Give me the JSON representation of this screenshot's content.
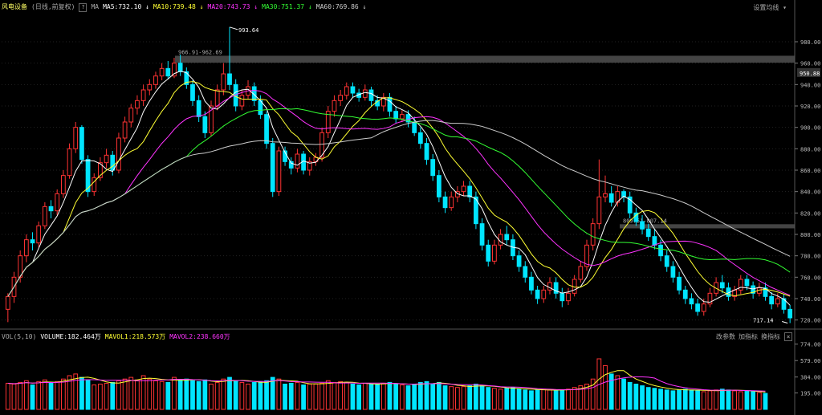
{
  "header": {
    "stock_name": "风电设备",
    "period": "(日线,前复权)",
    "help_label": "?",
    "ma_label": "MA",
    "ma_values": [
      {
        "label": "MA5:732.10",
        "color": "#ffffff"
      },
      {
        "label": "MA10:739.48",
        "color": "#ffff33"
      },
      {
        "label": "MA20:743.73",
        "color": "#ff33ff"
      },
      {
        "label": "MA30:751.37",
        "color": "#33ff33"
      },
      {
        "label": "MA60:769.86",
        "color": "#cccccc"
      }
    ],
    "settings_label": "设置均线"
  },
  "volume_header": {
    "title": "VOL(5,10)",
    "volume": "VOLUME:182.464万",
    "mavol1": "MAVOL1:218.573万",
    "mavol2": "MAVOL2:238.660万",
    "buttons": [
      "改参数",
      "加指标",
      "换指标"
    ],
    "close_label": "×"
  },
  "annotations": {
    "high_label": "993.64",
    "low_label": "717.14",
    "range1": "966.91-962.69",
    "range2": "809.51-807.14",
    "current_price": "950.88"
  },
  "colors": {
    "up": "#ff3333",
    "down": "#00e5ff",
    "ma5": "#ffffff",
    "ma10": "#ffff33",
    "ma20": "#ff33ff",
    "ma30": "#33ff33",
    "ma60": "#cccccc"
  },
  "chart_data": [
    {
      "type": "candlestick",
      "y_ticks": [
        980,
        960,
        940,
        920,
        900,
        880,
        860,
        840,
        820,
        800,
        780,
        760,
        740,
        720
      ],
      "ylim": [
        713,
        1004
      ],
      "candles": [
        [
          730,
          742,
          718,
          745
        ],
        [
          742,
          760,
          736,
          765
        ],
        [
          760,
          780,
          755,
          785
        ],
        [
          780,
          795,
          774,
          800
        ],
        [
          795,
          792,
          785,
          802
        ],
        [
          792,
          808,
          788,
          812
        ],
        [
          808,
          826,
          805,
          830
        ],
        [
          826,
          822,
          815,
          832
        ],
        [
          822,
          838,
          818,
          842
        ],
        [
          838,
          855,
          834,
          860
        ],
        [
          855,
          880,
          852,
          885
        ],
        [
          880,
          900,
          876,
          905
        ],
        [
          900,
          870,
          866,
          902
        ],
        [
          870,
          840,
          835,
          874
        ],
        [
          840,
          853,
          836,
          857
        ],
        [
          853,
          867,
          850,
          872
        ],
        [
          867,
          874,
          862,
          880
        ],
        [
          874,
          860,
          855,
          878
        ],
        [
          860,
          890,
          857,
          895
        ],
        [
          890,
          905,
          886,
          910
        ],
        [
          905,
          918,
          900,
          922
        ],
        [
          918,
          925,
          912,
          930
        ],
        [
          925,
          935,
          920,
          940
        ],
        [
          935,
          940,
          930,
          945
        ],
        [
          940,
          948,
          936,
          952
        ],
        [
          948,
          955,
          944,
          960
        ],
        [
          955,
          948,
          945,
          962
        ],
        [
          948,
          960,
          946,
          965
        ],
        [
          960,
          952,
          948,
          968
        ],
        [
          952,
          940,
          936,
          956
        ],
        [
          940,
          925,
          920,
          944
        ],
        [
          925,
          910,
          905,
          930
        ],
        [
          910,
          895,
          890,
          915
        ],
        [
          895,
          920,
          892,
          925
        ],
        [
          920,
          935,
          916,
          940
        ],
        [
          935,
          950,
          930,
          960
        ],
        [
          950,
          940,
          935,
          993.64
        ],
        [
          940,
          920,
          915,
          945
        ],
        [
          920,
          930,
          916,
          935
        ],
        [
          930,
          938,
          926,
          944
        ],
        [
          938,
          925,
          920,
          942
        ],
        [
          925,
          912,
          908,
          930
        ],
        [
          912,
          885,
          880,
          915
        ],
        [
          885,
          840,
          835,
          890
        ],
        [
          840,
          878,
          836,
          882
        ],
        [
          878,
          868,
          864,
          882
        ],
        [
          868,
          862,
          856,
          872
        ],
        [
          862,
          875,
          858,
          880
        ],
        [
          875,
          860,
          856,
          878
        ],
        [
          860,
          868,
          855,
          872
        ],
        [
          868,
          872,
          864,
          876
        ],
        [
          872,
          895,
          868,
          900
        ],
        [
          895,
          915,
          890,
          920
        ],
        [
          915,
          925,
          910,
          930
        ],
        [
          925,
          930,
          920,
          935
        ],
        [
          930,
          938,
          926,
          942
        ],
        [
          938,
          932,
          928,
          942
        ],
        [
          932,
          928,
          924,
          936
        ],
        [
          928,
          935,
          925,
          940
        ],
        [
          935,
          925,
          920,
          938
        ],
        [
          925,
          920,
          916,
          930
        ],
        [
          920,
          928,
          915,
          932
        ],
        [
          928,
          915,
          910,
          932
        ],
        [
          915,
          908,
          904,
          920
        ],
        [
          908,
          912,
          905,
          916
        ],
        [
          912,
          905,
          900,
          916
        ],
        [
          905,
          895,
          892,
          910
        ],
        [
          895,
          885,
          880,
          900
        ],
        [
          885,
          870,
          865,
          890
        ],
        [
          870,
          855,
          850,
          875
        ],
        [
          855,
          835,
          830,
          860
        ],
        [
          835,
          825,
          820,
          840
        ],
        [
          825,
          835,
          822,
          840
        ],
        [
          835,
          840,
          830,
          845
        ],
        [
          840,
          845,
          836,
          850
        ],
        [
          845,
          835,
          830,
          850
        ],
        [
          835,
          810,
          805,
          840
        ],
        [
          810,
          790,
          785,
          815
        ],
        [
          790,
          775,
          770,
          795
        ],
        [
          775,
          790,
          772,
          795
        ],
        [
          790,
          800,
          786,
          805
        ],
        [
          800,
          795,
          790,
          808
        ],
        [
          795,
          780,
          776,
          800
        ],
        [
          780,
          770,
          765,
          785
        ],
        [
          770,
          760,
          755,
          775
        ],
        [
          760,
          748,
          744,
          765
        ],
        [
          748,
          740,
          735,
          752
        ],
        [
          740,
          748,
          736,
          752
        ],
        [
          748,
          755,
          744,
          760
        ],
        [
          755,
          745,
          740,
          760
        ],
        [
          745,
          738,
          732,
          750
        ],
        [
          738,
          745,
          734,
          750
        ],
        [
          745,
          758,
          742,
          762
        ],
        [
          758,
          770,
          755,
          775
        ],
        [
          770,
          790,
          766,
          795
        ],
        [
          790,
          810,
          785,
          815
        ],
        [
          810,
          835,
          805,
          870
        ],
        [
          835,
          838,
          830,
          855
        ],
        [
          838,
          830,
          826,
          845
        ],
        [
          830,
          840,
          826,
          845
        ],
        [
          840,
          835,
          830,
          842
        ],
        [
          835,
          820,
          815,
          840
        ],
        [
          820,
          812,
          808,
          825
        ],
        [
          812,
          805,
          800,
          818
        ],
        [
          805,
          798,
          794,
          810
        ],
        [
          798,
          790,
          786,
          805
        ],
        [
          790,
          780,
          775,
          795
        ],
        [
          780,
          770,
          765,
          785
        ],
        [
          770,
          760,
          755,
          775
        ],
        [
          760,
          748,
          744,
          765
        ],
        [
          748,
          740,
          735,
          752
        ],
        [
          740,
          735,
          730,
          745
        ],
        [
          735,
          728,
          724,
          740
        ],
        [
          728,
          735,
          724,
          740
        ],
        [
          735,
          745,
          732,
          750
        ],
        [
          745,
          755,
          742,
          760
        ],
        [
          755,
          750,
          745,
          762
        ],
        [
          750,
          742,
          738,
          755
        ],
        [
          742,
          748,
          738,
          752
        ],
        [
          748,
          758,
          744,
          762
        ],
        [
          758,
          752,
          748,
          762
        ],
        [
          752,
          745,
          740,
          756
        ],
        [
          745,
          750,
          742,
          755
        ],
        [
          750,
          742,
          738,
          755
        ],
        [
          742,
          735,
          730,
          746
        ],
        [
          735,
          740,
          732,
          745
        ],
        [
          740,
          730,
          726,
          744
        ],
        [
          730,
          722,
          717.14,
          734
        ]
      ]
    },
    {
      "type": "bar",
      "y_ticks": [
        "774.00",
        "579.00",
        "384.00",
        "195.00"
      ],
      "ylim": [
        0,
        800
      ],
      "volumes": [
        310,
        300,
        320,
        340,
        290,
        330,
        350,
        310,
        330,
        360,
        400,
        420,
        380,
        350,
        290,
        300,
        310,
        320,
        340,
        360,
        380,
        350,
        400,
        360,
        340,
        330,
        320,
        380,
        350,
        360,
        340,
        330,
        350,
        300,
        320,
        360,
        380,
        340,
        320,
        300,
        320,
        330,
        340,
        380,
        360,
        300,
        310,
        320,
        290,
        300,
        300,
        310,
        340,
        320,
        330,
        320,
        300,
        290,
        310,
        300,
        300,
        310,
        320,
        300,
        290,
        280,
        300,
        320,
        330,
        300,
        320,
        280,
        270,
        260,
        270,
        280,
        300,
        280,
        260,
        250,
        240,
        250,
        260,
        240,
        230,
        220,
        230,
        240,
        230,
        220,
        230,
        240,
        260,
        280,
        300,
        360,
        600,
        520,
        420,
        400,
        360,
        320,
        300,
        280,
        260,
        250,
        240,
        230,
        220,
        230,
        240,
        230,
        220,
        210,
        220,
        230,
        240,
        230,
        220,
        210,
        220,
        210,
        200,
        190
      ]
    }
  ]
}
